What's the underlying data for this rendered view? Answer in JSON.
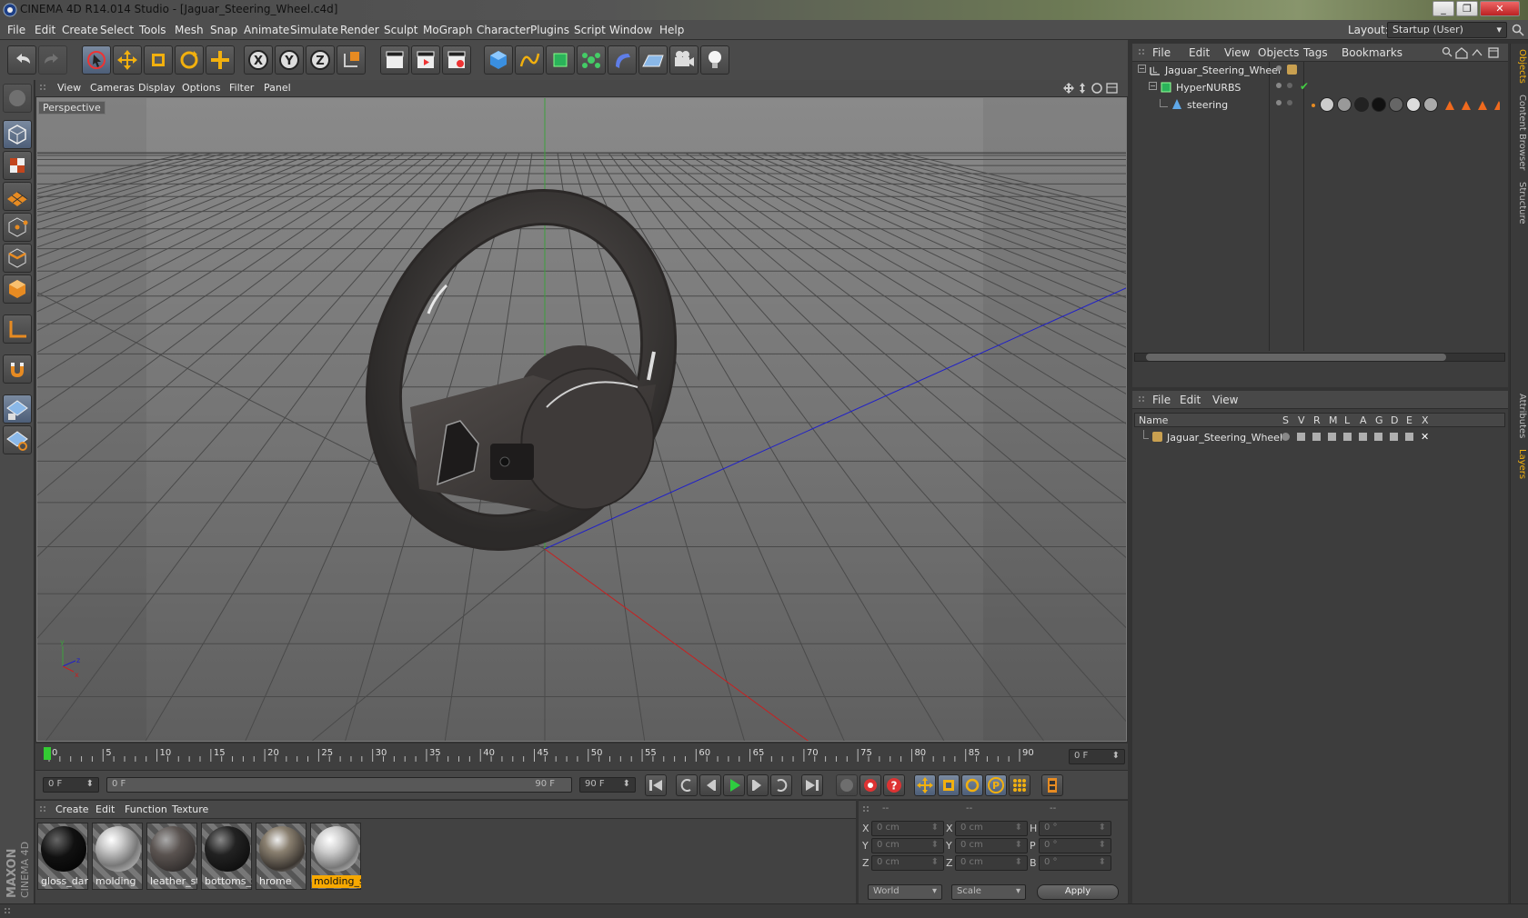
{
  "window": {
    "title": "CINEMA 4D R14.014 Studio - [Jaguar_Steering_Wheel.c4d]"
  },
  "menubar": {
    "items": [
      "File",
      "Edit",
      "Create",
      "Select",
      "Tools",
      "Mesh",
      "Snap",
      "Animate",
      "Simulate",
      "Render",
      "Sculpt",
      "MoGraph",
      "Character",
      "Plugins",
      "Script",
      "Window",
      "Help"
    ],
    "layout_label": "Layout:",
    "layout_value": "Startup (User)"
  },
  "viewport": {
    "menu": [
      "View",
      "Cameras",
      "Display",
      "Options",
      "Filter",
      "Panel"
    ],
    "label": "Perspective"
  },
  "timeline": {
    "ticks": [
      "0",
      "5",
      "10",
      "15",
      "20",
      "25",
      "30",
      "35",
      "40",
      "45",
      "50",
      "55",
      "60",
      "65",
      "70",
      "75",
      "80",
      "85",
      "90"
    ],
    "current_frame": "0 F",
    "start_field": "0 F",
    "range_start": "0 F",
    "range_end": "90 F",
    "end_field": "90 F"
  },
  "materials": {
    "menu": [
      "Create",
      "Edit",
      "Function",
      "Texture"
    ],
    "items": [
      {
        "name": "gloss_dark",
        "selected": false
      },
      {
        "name": "molding",
        "selected": false
      },
      {
        "name": "leather_ste",
        "selected": false
      },
      {
        "name": "bottoms_S",
        "selected": false
      },
      {
        "name": "hrome",
        "selected": false
      },
      {
        "name": "molding_st",
        "selected": true
      }
    ]
  },
  "coordinates": {
    "headers": [
      "--",
      "--",
      "--"
    ],
    "rows": [
      {
        "a": "X",
        "av": "0 cm",
        "b": "X",
        "bv": "0 cm",
        "c": "H",
        "cv": "0 °"
      },
      {
        "a": "Y",
        "av": "0 cm",
        "b": "Y",
        "bv": "0 cm",
        "c": "P",
        "cv": "0 °"
      },
      {
        "a": "Z",
        "av": "0 cm",
        "b": "Z",
        "bv": "0 cm",
        "c": "B",
        "cv": "0 °"
      }
    ],
    "mode": "World",
    "type": "Scale",
    "apply": "Apply"
  },
  "objects": {
    "menu": [
      "File",
      "Edit",
      "View",
      "Objects",
      "Tags",
      "Bookmarks"
    ],
    "tree": [
      {
        "name": "Jaguar_Steering_Wheel",
        "level": 0
      },
      {
        "name": "HyperNURBS",
        "level": 1
      },
      {
        "name": "steering",
        "level": 2
      }
    ]
  },
  "layers": {
    "menu": [
      "File",
      "Edit",
      "View"
    ],
    "name_header": "Name",
    "columns": [
      "S",
      "V",
      "R",
      "M",
      "L",
      "A",
      "G",
      "D",
      "E",
      "X"
    ],
    "rows": [
      {
        "name": "Jaguar_Steering_Wheel"
      }
    ]
  },
  "dock_tabs": [
    "Objects",
    "Content Browser",
    "Structure",
    "Attributes",
    "Layers"
  ],
  "brand": {
    "line1": "MAXON",
    "line2": "CINEMA 4D"
  }
}
